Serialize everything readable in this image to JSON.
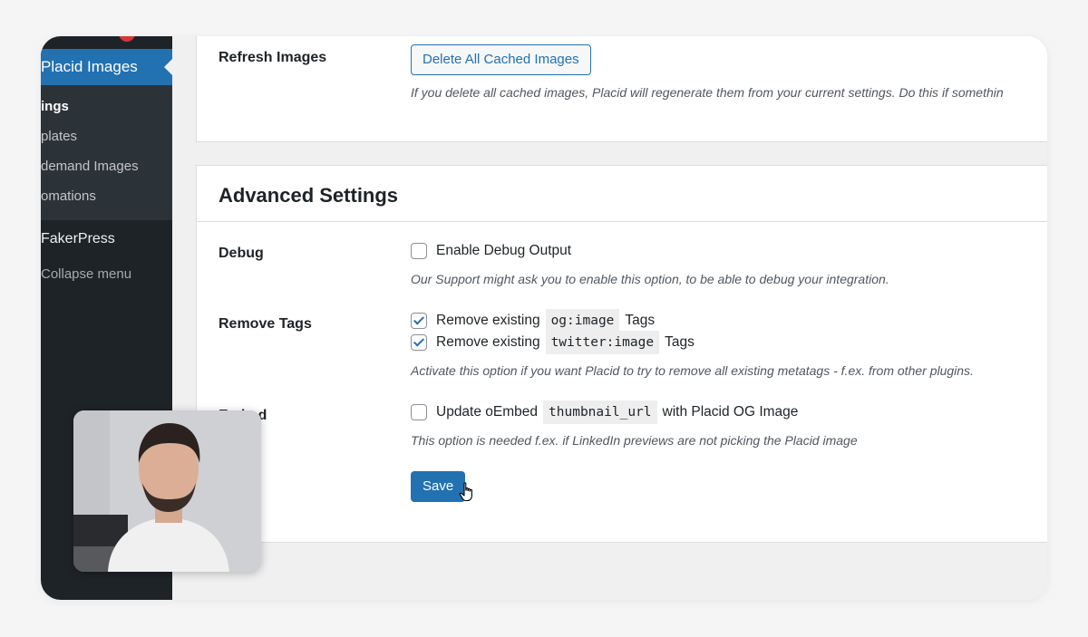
{
  "sidebar": {
    "current_menu": "Placid Images",
    "submenu": [
      "ings",
      "plates",
      "demand Images",
      "omations"
    ],
    "faker_label": "FakerPress",
    "collapse_label": "Collapse menu"
  },
  "refresh": {
    "label": "Refresh Images",
    "button": "Delete All Cached Images",
    "description": "If you delete all cached images, Placid will regenerate them from your current settings. Do this if somethin"
  },
  "advanced": {
    "title": "Advanced Settings",
    "debug": {
      "label": "Debug",
      "checkbox_label": "Enable Debug Output",
      "checked": false,
      "description": "Our Support might ask you to enable this option, to be able to debug your integration."
    },
    "remove_tags": {
      "label": "Remove Tags",
      "og": {
        "prefix": "Remove existing",
        "code": "og:image",
        "suffix": "Tags",
        "checked": true
      },
      "twitter": {
        "prefix": "Remove existing",
        "code": "twitter:image",
        "suffix": "Tags",
        "checked": true
      },
      "description": "Activate this option if you want Placid to try to remove all existing metatags - f.ex. from other plugins."
    },
    "oembed": {
      "label": "Embed",
      "prefix": "Update oEmbed",
      "code": "thumbnail_url",
      "suffix": "with Placid OG Image",
      "checked": false,
      "description": "This option is needed f.ex. if LinkedIn previews are not picking the Placid image"
    },
    "save_button": "Save"
  },
  "colors": {
    "sidebar_bg": "#1d2327",
    "submenu_bg": "#2c3338",
    "accent": "#2271b1",
    "badge": "#d63638"
  }
}
